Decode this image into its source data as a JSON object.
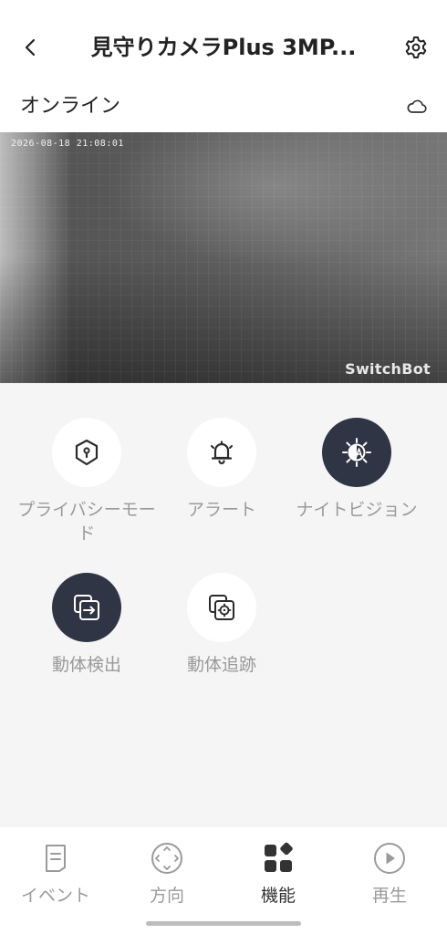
{
  "header": {
    "title": "見守りカメラPlus 3MP...",
    "back_icon": "chevron-left-icon",
    "settings_icon": "gear-icon"
  },
  "status": {
    "text": "オンライン",
    "cloud_icon": "cloud-icon"
  },
  "video": {
    "timestamp": "2026-08-18 21:08:01",
    "watermark": "SwitchBot"
  },
  "features": [
    {
      "label": "プライバシーモード",
      "icon": "privacy-shield-icon",
      "active": false
    },
    {
      "label": "アラート",
      "icon": "bell-icon",
      "active": false
    },
    {
      "label": "ナイトビジョン",
      "icon": "night-vision-auto-icon",
      "active": true
    },
    {
      "label": "動体検出",
      "icon": "motion-detection-icon",
      "active": true
    },
    {
      "label": "動体追跡",
      "icon": "motion-tracking-icon",
      "active": false
    }
  ],
  "tabs": [
    {
      "label": "イベント",
      "icon": "event-list-icon",
      "active": false
    },
    {
      "label": "方向",
      "icon": "direction-pad-icon",
      "active": false
    },
    {
      "label": "機能",
      "icon": "features-grid-icon",
      "active": true
    },
    {
      "label": "再生",
      "icon": "play-icon",
      "active": false
    }
  ],
  "colors": {
    "accent_dark": "#2f3545",
    "background": "#f5f5f5",
    "inactive_text": "#9a9a9a"
  }
}
